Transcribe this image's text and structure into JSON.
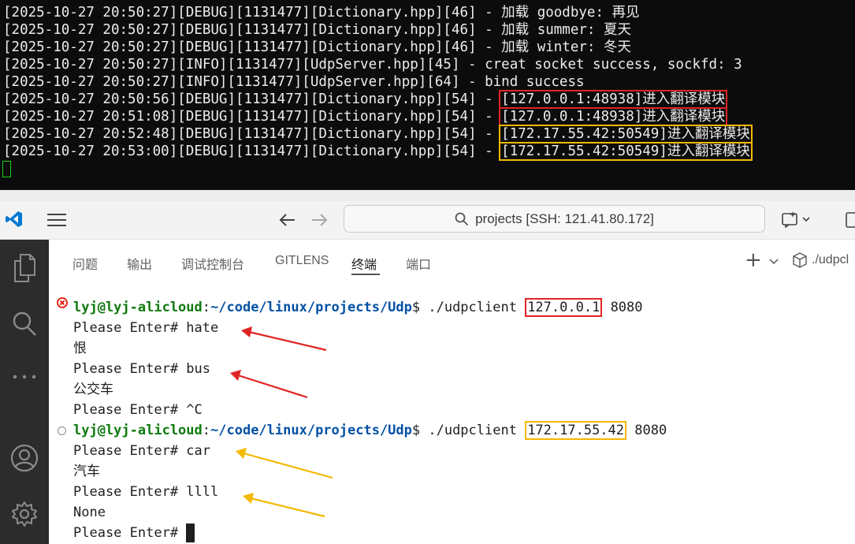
{
  "top_terminal": {
    "lines": [
      "[2025-10-27 20:50:27][DEBUG][1131477][Dictionary.hpp][46] - 加载 goodbye: 再见",
      "[2025-10-27 20:50:27][DEBUG][1131477][Dictionary.hpp][46] - 加载 summer: 夏天",
      "[2025-10-27 20:50:27][DEBUG][1131477][Dictionary.hpp][46] - 加载 winter: 冬天",
      "[2025-10-27 20:50:27][INFO][1131477][UdpServer.hpp][45] - creat socket success, sockfd: 3",
      "[2025-10-27 20:50:27][INFO][1131477][UdpServer.hpp][64] - bind success"
    ],
    "highlighted": [
      {
        "prefix": "[2025-10-27 20:50:56][DEBUG][1131477][Dictionary.hpp][54] - ",
        "boxed": "[127.0.0.1:48938]进入翻译模块",
        "color": "#e02424"
      },
      {
        "prefix": "[2025-10-27 20:51:08][DEBUG][1131477][Dictionary.hpp][54] - ",
        "boxed": "[127.0.0.1:48938]进入翻译模块",
        "color": "#e02424"
      },
      {
        "prefix": "[2025-10-27 20:52:48][DEBUG][1131477][Dictionary.hpp][54] - ",
        "boxed": "[172.17.55.42:50549]进入翻译模块",
        "color": "#f5b800"
      },
      {
        "prefix": "[2025-10-27 20:53:00][DEBUG][1131477][Dictionary.hpp][54] - ",
        "boxed": "[172.17.55.42:50549]进入翻译模块",
        "color": "#f5b800"
      }
    ]
  },
  "titlebar": {
    "search_text": "projects [SSH: 121.41.80.172]"
  },
  "panel": {
    "tabs": [
      "问题",
      "输出",
      "调试控制台",
      "GITLENS",
      "终端",
      "端口"
    ],
    "active_tab": "终端",
    "terminal_name": "./udpcl"
  },
  "terminal": {
    "session1": {
      "user_host": "lyj@lyj-alicloud",
      "path": "~/code/linux/projects/Udp",
      "cmd_before": "$ ./udpclient ",
      "ip": "127.0.0.1",
      "port": "8080",
      "box_color": "#e02424",
      "status": "error",
      "lines": [
        "Please Enter# hate",
        "恨",
        "Please Enter# bus",
        "公交车",
        "Please Enter# ^C"
      ]
    },
    "session2": {
      "user_host": "lyj@lyj-alicloud",
      "path": "~/code/linux/projects/Udp",
      "cmd_before": "$ ./udpclient ",
      "ip": "172.17.55.42",
      "port": "8080",
      "box_color": "#f5b800",
      "status": "running",
      "lines": [
        "Please Enter# car",
        "汽车",
        "Please Enter# llll",
        "None",
        "Please Enter# "
      ]
    }
  },
  "colors": {
    "annotation_red": "#e02424",
    "annotation_yellow": "#f5b800",
    "prompt_user": "#0e7a0d",
    "prompt_path": "#0451a5",
    "vscode_blue": "#0078d4"
  }
}
